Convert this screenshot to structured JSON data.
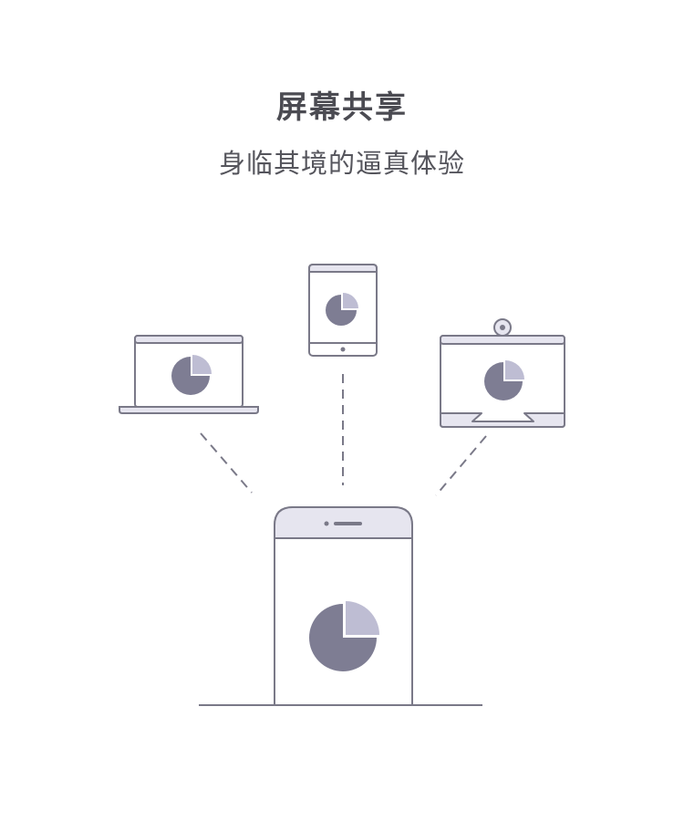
{
  "header": {
    "title": "屏幕共享",
    "subtitle": "身临其境的逼真体验"
  },
  "colors": {
    "stroke": "#7a7988",
    "pie_dark": "#7e7d93",
    "pie_light": "#bebdd3",
    "panel_fill": "#e6e5ef"
  },
  "devices": [
    "laptop-icon",
    "tablet-icon",
    "smart-display-icon",
    "phone-icon"
  ]
}
